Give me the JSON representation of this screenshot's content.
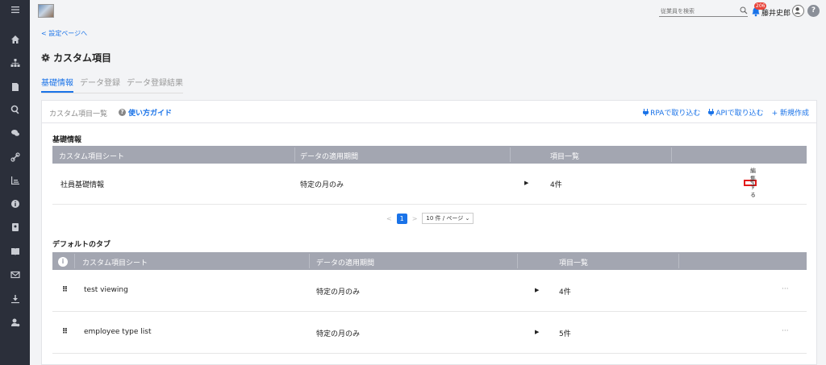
{
  "sidebar": {
    "icons": [
      "menu-icon",
      "home-icon",
      "org-chart-icon",
      "document-icon",
      "search-icon",
      "chat-icon",
      "link-icon",
      "chart-icon",
      "info-icon",
      "contact-card-icon",
      "book-icon",
      "mail-icon",
      "download-icon",
      "user-settings-icon"
    ]
  },
  "topbar": {
    "search_placeholder": "従業員を検索",
    "notification_count": "206",
    "username": "藤井史郎",
    "help_label": "?"
  },
  "back_link": "< 設定ページへ",
  "page_title": "カスタム項目",
  "tabs": [
    {
      "label": "基礎情報",
      "active": true
    },
    {
      "label": "データ登録",
      "active": false
    },
    {
      "label": "データ登録結果",
      "active": false
    }
  ],
  "card": {
    "crumb": "カスタム項目一覧",
    "guide": "使い方ガイド",
    "actions": {
      "rpa": "RPAで取り込む",
      "api": "APIで取り込む",
      "new": "+ 新規作成"
    }
  },
  "basic": {
    "title": "基礎情報",
    "columns": [
      "カスタム項目シート",
      "データの適用期間",
      "項目一覧"
    ],
    "rows": [
      {
        "sheet": "社員基礎情報",
        "period": "特定の月のみ",
        "count": "4件",
        "edit": "編集する"
      }
    ],
    "pager": {
      "prev": "<",
      "page": "1",
      "next": ">",
      "size": "10 件 / ページ"
    }
  },
  "default_tab": {
    "title": "デフォルトのタブ",
    "columns": [
      "カスタム項目シート",
      "データの適用期間",
      "項目一覧"
    ],
    "rows": [
      {
        "sheet": "test viewing",
        "period": "特定の月のみ",
        "count": "4件"
      },
      {
        "sheet": "employee type list",
        "period": "特定の月のみ",
        "count": "5件"
      }
    ]
  }
}
